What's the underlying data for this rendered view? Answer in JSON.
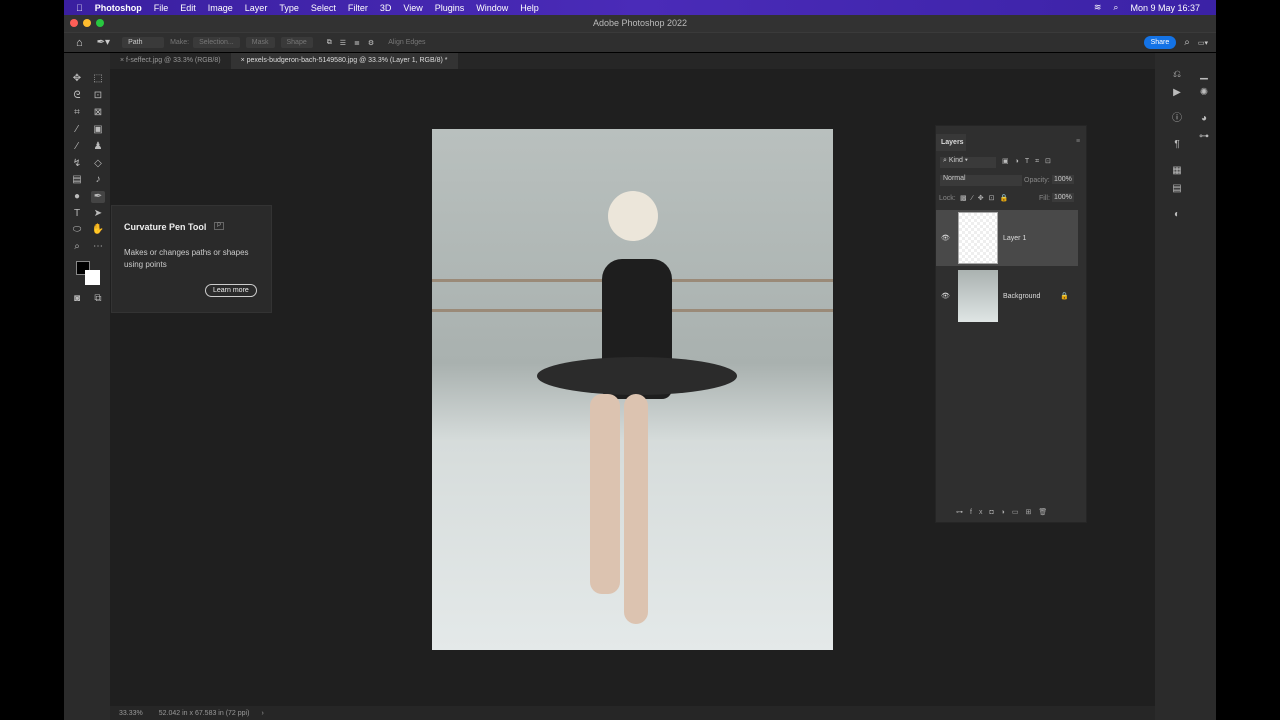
{
  "menubar": {
    "app": "Photoshop",
    "items": [
      "File",
      "Edit",
      "Image",
      "Layer",
      "Type",
      "Select",
      "Filter",
      "3D",
      "View",
      "Plugins",
      "Window",
      "Help"
    ],
    "clock": "Mon 9 May  16:37"
  },
  "window": {
    "title": "Adobe Photoshop 2022"
  },
  "options": {
    "mode": "Path",
    "make_label": "Make:",
    "selection": "Selection...",
    "mask": "Mask",
    "shape": "Shape",
    "align_edges": "Align Edges",
    "share": "Share"
  },
  "tabs": [
    {
      "label": "f-seffect.jpg @ 33.3% (RGB/8)"
    },
    {
      "label": "pexels-budgeron-bach-5149580.jpg @ 33.3% (Layer 1, RGB/8) *"
    }
  ],
  "tooltip": {
    "title": "Curvature Pen Tool",
    "shortcut": "P",
    "description": "Makes or changes paths or shapes using points",
    "learn_more": "Learn more"
  },
  "status": {
    "zoom": "33.33%",
    "dimensions": "52.042 in x 67.583 in (72 ppi)",
    "arrow": "›"
  },
  "layers_panel": {
    "title": "Layers",
    "filter": "Kind",
    "blend": "Normal",
    "opacity_label": "Opacity:",
    "opacity": "100%",
    "lock_label": "Lock:",
    "fill_label": "Fill:",
    "fill": "100%",
    "layers": [
      {
        "name": "Layer 1",
        "selected": true
      },
      {
        "name": "Background",
        "locked": true
      }
    ]
  },
  "colors": {
    "menubar": "#3f24ad",
    "share": "#1473e6",
    "foreground": "#000000",
    "background": "#ffffff"
  }
}
